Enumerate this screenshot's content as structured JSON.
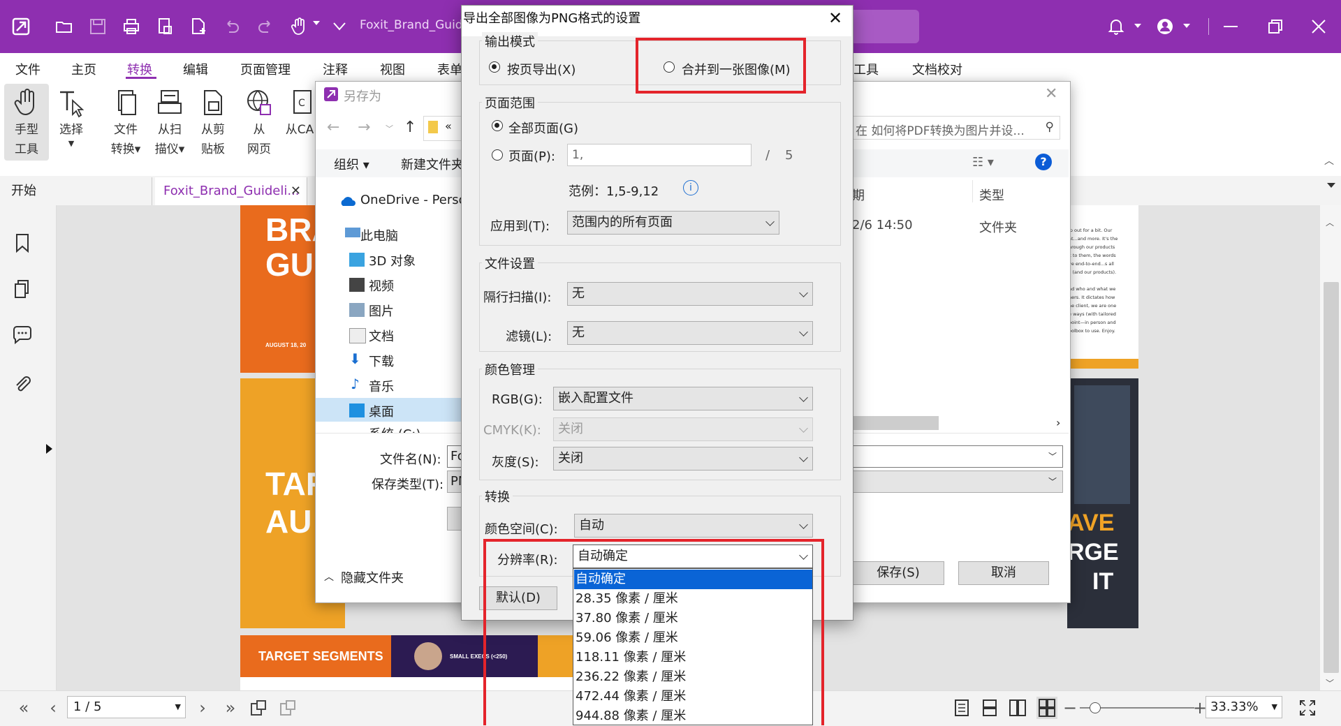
{
  "window": {
    "app_title": "Foxit_Brand_Guid",
    "accent": "#8e2fb0"
  },
  "menu": {
    "items": [
      "文件",
      "主页",
      "转换",
      "编辑",
      "页面管理",
      "注释",
      "视图",
      "表单",
      "工具",
      "文档校对"
    ],
    "active": "转换"
  },
  "ribbon": {
    "hand_tool": [
      "手型",
      "工具"
    ],
    "select": [
      "选择"
    ],
    "file_convert": [
      "文件",
      "转换▾"
    ],
    "from_scanner": [
      "从扫",
      "描仪▾"
    ],
    "from_clipboard": [
      "从剪",
      "贴板"
    ],
    "from_web": [
      "从",
      "网页"
    ],
    "from_cad": [
      "从CA"
    ]
  },
  "tabs": {
    "start": "开始",
    "document": "Foxit_Brand_Guideli..."
  },
  "pages": {
    "p1_line1": "BRA",
    "p1_line2": "GU",
    "p1_date": "AUGUST 18, 20",
    "p2_line1": "TAR",
    "p2_line2": "AU",
    "p3_segments": "TARGET SEGMENTS",
    "p3_small": "SMALL EXECS (<250)",
    "right_text": "lp out for a bit. Our\nat...and more. It's the\nhrough our products\nk to them, the words\nve end-to-end...s all\ns (and our products).\n\nnd who and what we\nners. It dictates how\nhe client, we are one\ne ways (with tailored\npoint—in person and\noolbox to use. Enjoy.",
    "right_big1": "AVE",
    "right_big2": "RGE",
    "right_big3": "IT"
  },
  "status": {
    "page": "1 / 5",
    "zoom": "33.33%"
  },
  "saveas": {
    "title": "另存为",
    "search_placeholder": "在 如何将PDF转换为图片并设...",
    "organize": "组织 ▾",
    "new_folder": "新建文件夹",
    "col_date": "期",
    "col_type": "类型",
    "row_date": "2/6 14:50",
    "row_type": "文件夹",
    "tree": [
      "OneDrive - Perso",
      "此电脑",
      "3D 对象",
      "视频",
      "图片",
      "文档",
      "下载",
      "音乐",
      "桌面",
      "系统 (C:)"
    ],
    "filename_label": "文件名(N):",
    "filename_value": "Fo",
    "filetype_label": "保存类型(T):",
    "filetype_value": "PN",
    "hide_folders": "隐藏文件夹",
    "save": "保存(S)",
    "cancel": "取消",
    "breadcrumb": "«"
  },
  "png": {
    "title": "导出全部图像为PNG格式的设置",
    "output_mode": "输出模式",
    "by_page": "按页导出(X)",
    "merge": "合并到一张图像(M)",
    "page_range": "页面范围",
    "all_pages": "全部页面(G)",
    "pages": "页面(P):",
    "pages_value": "1,",
    "total_sep": "/",
    "total": "5",
    "example": "范例：1,5-9,12",
    "apply_to": "应用到(T):",
    "apply_value": "范围内的所有页面",
    "file_settings": "文件设置",
    "interlace": "隔行扫描(I):",
    "interlace_value": "无",
    "filter": "滤镜(L):",
    "filter_value": "无",
    "color_mgmt": "颜色管理",
    "rgb": "RGB(G):",
    "rgb_value": "嵌入配置文件",
    "cmyk": "CMYK(K):",
    "cmyk_value": "关闭",
    "gray": "灰度(S):",
    "gray_value": "关闭",
    "convert": "转换",
    "color_space": "颜色空间(C):",
    "color_space_value": "自动",
    "resolution": "分辨率(R):",
    "resolution_value": "自动确定",
    "default_btn": "默认(D)",
    "options": [
      "自动确定",
      "28.35 像素 / 厘米",
      "37.80 像素 / 厘米",
      "59.06 像素 / 厘米",
      "118.11 像素 / 厘米",
      "236.22  像素 / 厘米",
      "472.44 像素 / 厘米",
      "944.88 像素 / 厘米"
    ],
    "selected_option": "自动确定"
  }
}
